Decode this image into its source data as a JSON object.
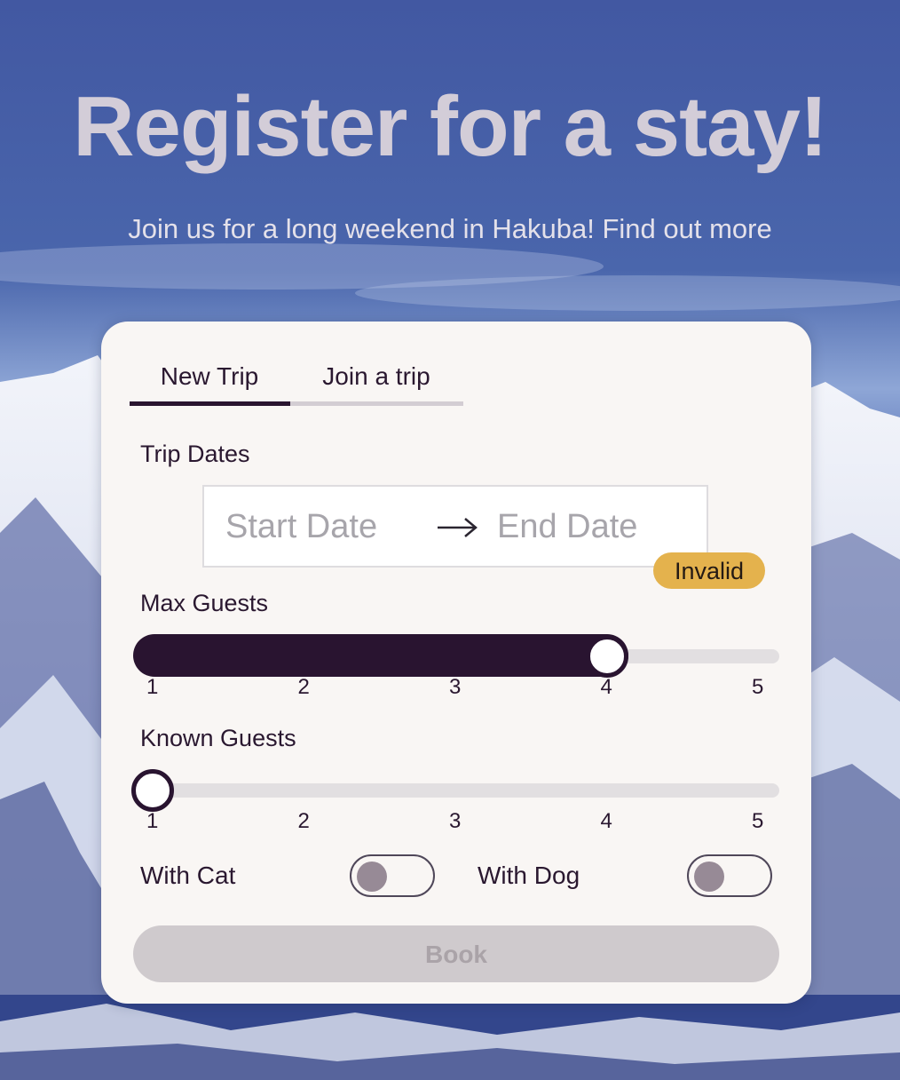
{
  "hero": {
    "title": "Register for a stay!",
    "subtitle": "Join us for a long weekend in Hakuba! Find out more"
  },
  "tabs": [
    {
      "label": "New Trip",
      "active": true
    },
    {
      "label": "Join a trip",
      "active": false
    }
  ],
  "trip_dates": {
    "label": "Trip Dates",
    "start_placeholder": "Start Date",
    "end_placeholder": "End Date",
    "arrow_icon": "arrow-right-icon",
    "validation_badge": "Invalid"
  },
  "max_guests": {
    "label": "Max Guests",
    "value": 4,
    "min": 1,
    "max": 5,
    "ticks": [
      "1",
      "2",
      "3",
      "4",
      "5"
    ]
  },
  "known_guests": {
    "label": "Known Guests",
    "value": 1,
    "min": 1,
    "max": 5,
    "ticks": [
      "1",
      "2",
      "3",
      "4",
      "5"
    ]
  },
  "toggles": {
    "with_cat": {
      "label": "With Cat",
      "on": false
    },
    "with_dog": {
      "label": "With Dog",
      "on": false
    }
  },
  "book_button": {
    "label": "Book",
    "disabled": true
  },
  "colors": {
    "primary": "#291430",
    "badge": "#e4b24d",
    "card": "#f9f6f4",
    "sky": "#4660a4"
  }
}
